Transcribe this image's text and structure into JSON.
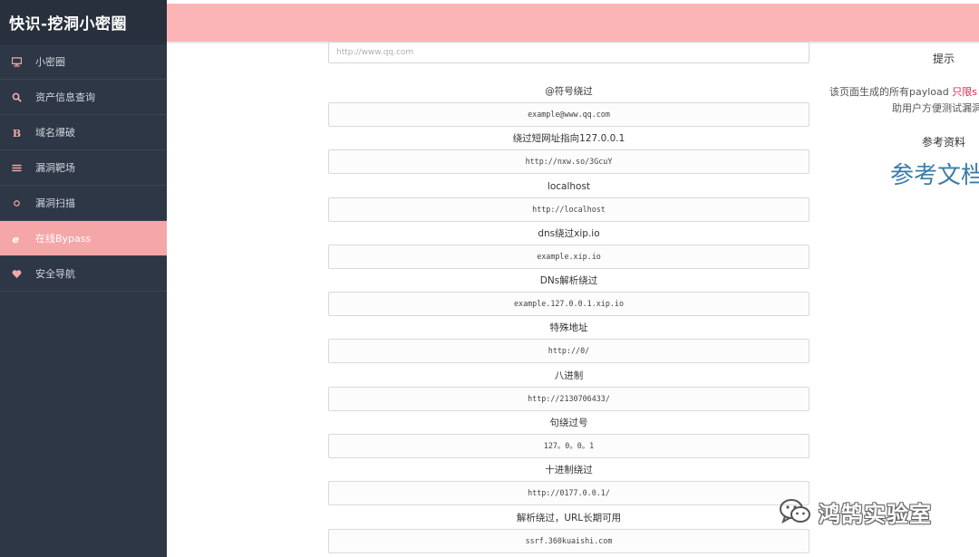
{
  "sidebar": {
    "brand": "快识-挖洞小密圈",
    "items": [
      {
        "label": "小密圈",
        "icon": "monitor-icon"
      },
      {
        "label": "资产信息查询",
        "icon": "search-icon"
      },
      {
        "label": "域名爆破",
        "icon": "bold-b-icon"
      },
      {
        "label": "漏洞靶场",
        "icon": "list-icon"
      },
      {
        "label": "漏洞扫描",
        "icon": "circle-icon"
      },
      {
        "label": "在线Bypass",
        "icon": "ie-icon",
        "active": true
      },
      {
        "label": "安全导航",
        "icon": "heart-icon"
      }
    ]
  },
  "main": {
    "url_placeholder": "http://www.qq.com",
    "payloads": [
      {
        "label": "@符号绕过",
        "value": "example@www.qq.com"
      },
      {
        "label": "绕过短网址指向127.0.0.1",
        "value": "http://nxw.so/3GcuY"
      },
      {
        "label": "localhost",
        "value": "http://localhost"
      },
      {
        "label": "dns绕过xip.io",
        "value": "example.xip.io"
      },
      {
        "label": "DNs解析绕过",
        "value": "example.127.0.0.1.xip.io"
      },
      {
        "label": "特殊地址",
        "value": "http://0/"
      },
      {
        "label": "八进制",
        "value": "http://2130706433/"
      },
      {
        "label": "句绕过号",
        "value": "127。0。0。1"
      },
      {
        "label": "十进制绕过",
        "value": "http://0177.0.0.1/"
      },
      {
        "label": "解析绕过，URL长期可用",
        "value": "ssrf.360kuaishi.com"
      }
    ]
  },
  "right_panel": {
    "tip_title": "提示",
    "tip_text_1": "该页面生成的所有payload",
    "tip_highlight": "只限s",
    "tip_text_2": "助用户方便测试漏洞",
    "ref_title": "参考资料",
    "ref_link": "参考文档"
  },
  "watermark": {
    "text": "鸿鹄实验室"
  },
  "colors": {
    "sidebar_bg": "#2d3745",
    "topbar_bg": "#fcb5b6",
    "active_item_bg": "#f5a7a8",
    "icon_accent": "#f5a7a8",
    "highlight_red": "#e0254a",
    "link_blue": "#3a7ca8"
  }
}
